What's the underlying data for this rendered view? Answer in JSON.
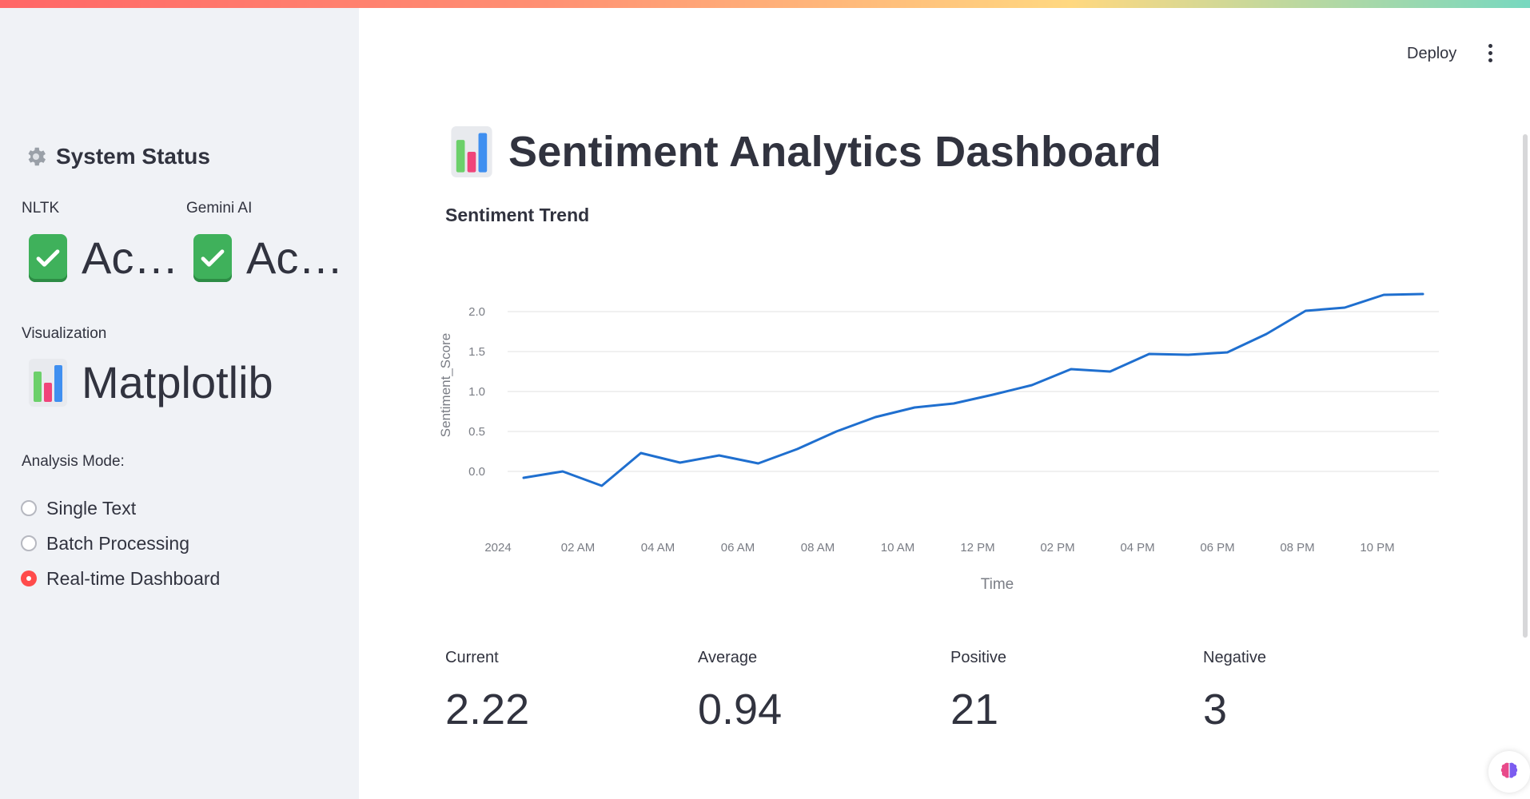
{
  "app": {
    "deploy_label": "Deploy",
    "menu_icon": "kebab-menu-icon"
  },
  "sidebar": {
    "title": "System Status",
    "title_icon": "gear-icon",
    "status": [
      {
        "label": "NLTK",
        "value": "Ac…",
        "icon": "check-icon"
      },
      {
        "label": "Gemini AI",
        "value": "Ac…",
        "icon": "check-icon"
      }
    ],
    "visualization": {
      "label": "Visualization",
      "value": "Matplotlib",
      "icon": "bar-chart-icon"
    },
    "analysis_mode": {
      "label": "Analysis Mode:",
      "options": [
        "Single Text",
        "Batch Processing",
        "Real-time Dashboard"
      ],
      "selected": "Real-time Dashboard"
    }
  },
  "main": {
    "title": "Sentiment Analytics Dashboard",
    "title_icon": "bar-chart-icon",
    "section_title": "Sentiment Trend",
    "metrics": [
      {
        "label": "Current",
        "value": "2.22"
      },
      {
        "label": "Average",
        "value": "0.94"
      },
      {
        "label": "Positive",
        "value": "21"
      },
      {
        "label": "Negative",
        "value": "3"
      }
    ]
  },
  "chart_data": {
    "type": "line",
    "xlabel": "Time",
    "ylabel": "Sentiment_Score",
    "ylim": [
      -0.3,
      2.4
    ],
    "yticks": [
      "0.0",
      "0.5",
      "1.0",
      "1.5",
      "2.0"
    ],
    "xticks": [
      "2024",
      "02 AM",
      "04 AM",
      "06 AM",
      "08 AM",
      "10 AM",
      "12 PM",
      "02 PM",
      "04 PM",
      "06 PM",
      "08 PM",
      "10 PM"
    ],
    "grid": true,
    "color": "#1f6fcf",
    "x": [
      0,
      1,
      2,
      3,
      4,
      5,
      6,
      7,
      8,
      9,
      10,
      11,
      12,
      13,
      14,
      15,
      16,
      17,
      18,
      19,
      20,
      21,
      22,
      23
    ],
    "y": [
      -0.08,
      0.0,
      -0.18,
      0.23,
      0.11,
      0.2,
      0.1,
      0.28,
      0.5,
      0.68,
      0.8,
      0.85,
      0.96,
      1.08,
      1.28,
      1.25,
      1.47,
      1.46,
      1.49,
      1.72,
      2.01,
      2.05,
      2.21,
      2.22
    ]
  }
}
